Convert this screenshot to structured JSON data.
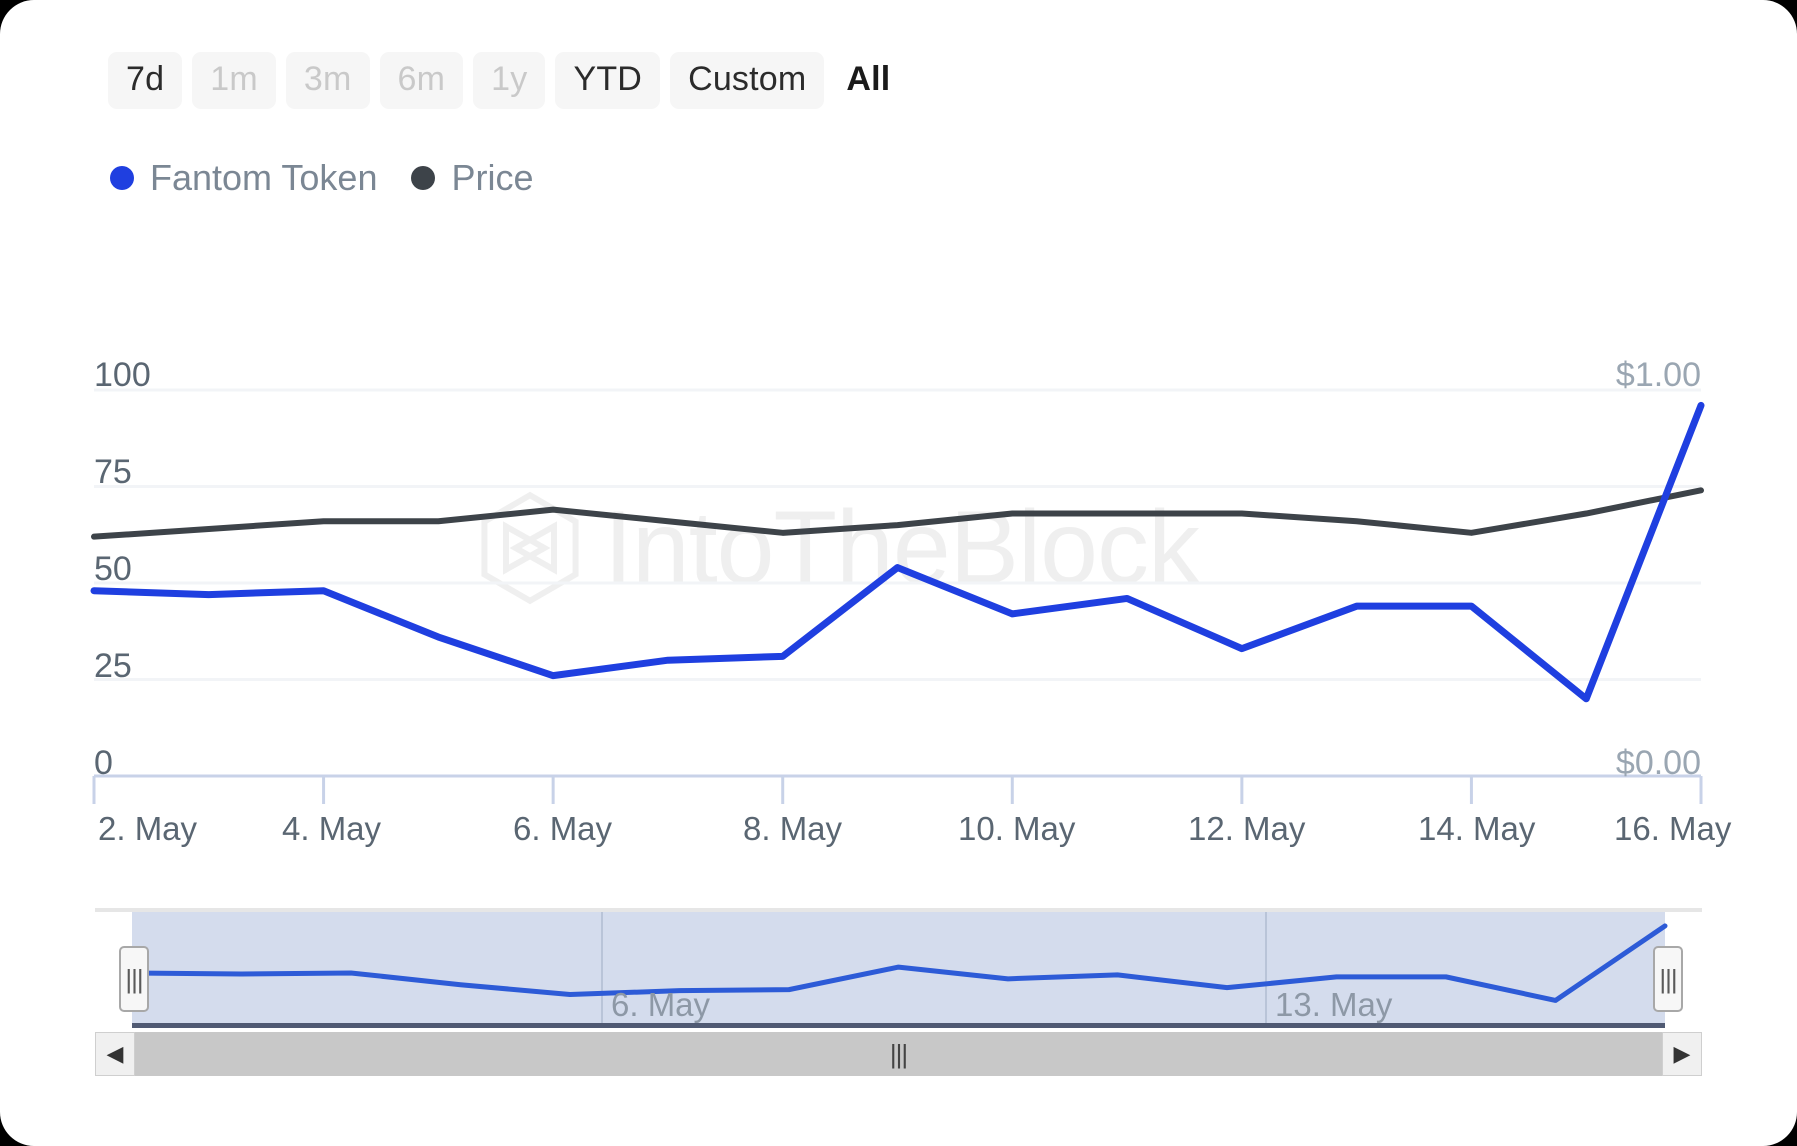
{
  "range_selector": {
    "buttons": [
      {
        "label": "7d",
        "state": "enabled"
      },
      {
        "label": "1m",
        "state": "disabled"
      },
      {
        "label": "3m",
        "state": "disabled"
      },
      {
        "label": "6m",
        "state": "disabled"
      },
      {
        "label": "1y",
        "state": "disabled"
      },
      {
        "label": "YTD",
        "state": "enabled"
      },
      {
        "label": "Custom",
        "state": "enabled"
      },
      {
        "label": "All",
        "state": "selected"
      }
    ]
  },
  "legend": {
    "items": [
      {
        "label": "Fantom Token",
        "color": "#1f3fe0"
      },
      {
        "label": "Price",
        "color": "#3d4349"
      }
    ]
  },
  "watermark": {
    "text": "IntoTheBlock",
    "color": "#efefef"
  },
  "navigator": {
    "x_labels": [
      "6. May",
      "13. May"
    ],
    "handle_grip": "|||",
    "scrollbar": {
      "left_arrow": "◀",
      "right_arrow": "▶",
      "grip": "|||"
    }
  },
  "chart_data": {
    "type": "line",
    "title": "",
    "xlabel": "",
    "ylabel": "",
    "grid": true,
    "legend_position": "top-left",
    "x_tick_labels": [
      "2. May",
      "4. May",
      "6. May",
      "8. May",
      "10. May",
      "12. May",
      "14. May",
      "16. May"
    ],
    "y_left": {
      "label": "",
      "ticks": [
        "0",
        "25",
        "50",
        "75",
        "100"
      ],
      "tick_values": [
        0,
        25,
        50,
        75,
        100
      ],
      "ylim": [
        0,
        100
      ]
    },
    "y_right": {
      "label": "",
      "ticks": [
        "$0.00",
        "$1.00"
      ],
      "tick_values": [
        0,
        1
      ],
      "ylim": [
        0,
        1
      ]
    },
    "x": [
      "2. May",
      "3. May",
      "4. May",
      "5. May",
      "6. May",
      "7. May",
      "8. May",
      "9. May",
      "10. May",
      "11. May",
      "12. May",
      "13. May",
      "14. May",
      "15. May",
      "16. May"
    ],
    "series": [
      {
        "name": "Fantom Token",
        "color": "#1f3fe0",
        "axis": "left",
        "values": [
          48,
          47,
          48,
          36,
          26,
          30,
          31,
          54,
          42,
          46,
          33,
          44,
          44,
          20,
          96
        ]
      },
      {
        "name": "Price",
        "color": "#3d4349",
        "axis": "left",
        "values": [
          62,
          64,
          66,
          66,
          69,
          66,
          63,
          65,
          68,
          68,
          68,
          66,
          63,
          68,
          74
        ]
      }
    ],
    "navigator_series": {
      "name": "Fantom Token",
      "color": "#2d5bd7",
      "values": [
        48,
        47,
        48,
        36,
        26,
        30,
        31,
        54,
        42,
        46,
        33,
        44,
        44,
        20,
        96
      ]
    }
  }
}
